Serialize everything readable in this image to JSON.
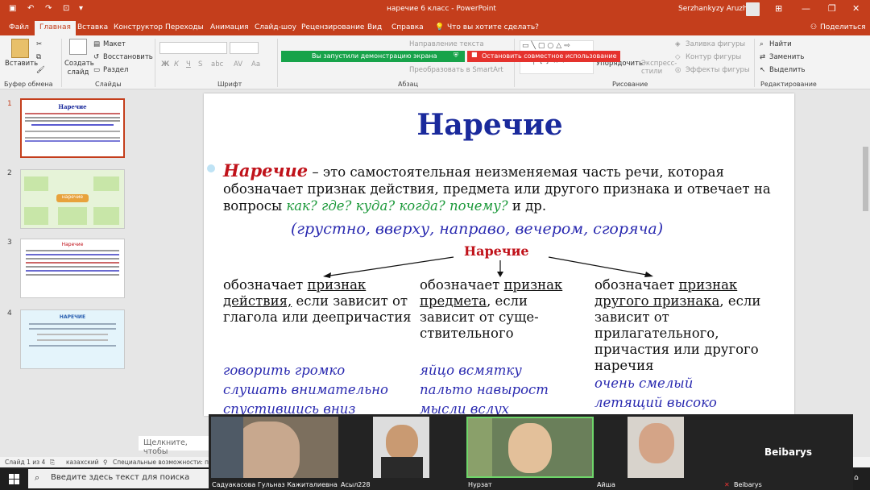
{
  "app": {
    "doc_title": "наречие 6 класс - PowerPoint",
    "user": "Serzhankyzy Aruzhan",
    "share": "Поделиться"
  },
  "tabs": [
    "Файл",
    "Главная",
    "Вставка",
    "Конструктор",
    "Переходы",
    "Анимация",
    "Слайд-шоу",
    "Рецензирование",
    "Вид",
    "Справка",
    "Что вы хотите сделать?"
  ],
  "ribbon": {
    "paste": "Вставить",
    "new_slide": "Создать слайд",
    "layout": "Макет",
    "reset": "Восстановить",
    "section": "Раздел",
    "direction": "Направление текста",
    "smartart": "Преобразовать в SmartArt",
    "arrange": "Упорядочить",
    "express": "Экспресс-стили",
    "shape_fill": "Заливка фигуры",
    "shape_outline": "Контур фигуры",
    "shape_effects": "Эффекты фигуры",
    "find": "Найти",
    "replace": "Заменить",
    "select": "Выделить",
    "groups": {
      "clipboard": "Буфер обмена",
      "slides": "Слайды",
      "font": "Шрифт",
      "paragraph": "Абзац",
      "drawing": "Рисование",
      "editing": "Редактирование"
    }
  },
  "notifications": {
    "sharing": "Вы запустили демонстрацию экрана",
    "stop": "Остановить совместное использование"
  },
  "thumbs": [
    "1",
    "2",
    "3",
    "4"
  ],
  "thumb_content": {
    "t1_title": "Наречие",
    "t2_center": "наречие",
    "t3_title": "Наречие",
    "t4_title": "НАРЕЧИЕ"
  },
  "slide": {
    "title": "Наречие",
    "term": "Наречие",
    "def1": " – это самостоятельная неизменяемая часть речи, которая обозначает признак действия, предмета или другого признака и отвечает на вопросы ",
    "questions": "как? где? куда? когда? почему?",
    "def2": " и др.",
    "examples": "(грустно, вверху, направо, вечером, сгоряча)",
    "subtitle": "Наречие",
    "col1_pre": "обозначает ",
    "col1_u": "признак действия,",
    "col1_post": " если зависит от глагола или деепричастия",
    "col2_pre": "обозначает ",
    "col2_u": "признак предмета",
    "col2_post": ", если зависит от суще-ствительного",
    "col3_pre": "обозначает ",
    "col3_u": "признак другого признака",
    "col3_post": ", если зависит от прилагательного, причастия или другого наречия",
    "ex1": [
      "говорить громко",
      "слушать внимательно",
      "спустившись вниз"
    ],
    "ex2": [
      "яйцо всмятку",
      "пальто навырост",
      "мысли вслух"
    ],
    "ex3": [
      "очень смелый",
      "летящий высоко"
    ]
  },
  "notes_placeholder": "Щелкните, чтобы",
  "status": {
    "slide": "Слайд 1 из 4",
    "lang": "казахский",
    "access": "Специальные возможности: проверь"
  },
  "taskbar": {
    "search": "Введите здесь текст для поиска"
  },
  "zoom": {
    "names": [
      "Садуакасова Гульназ Кажиталиевна",
      "Асыл228",
      "Нурзат",
      "Айша",
      "Beibarys"
    ],
    "big_name": "Beibarys"
  }
}
